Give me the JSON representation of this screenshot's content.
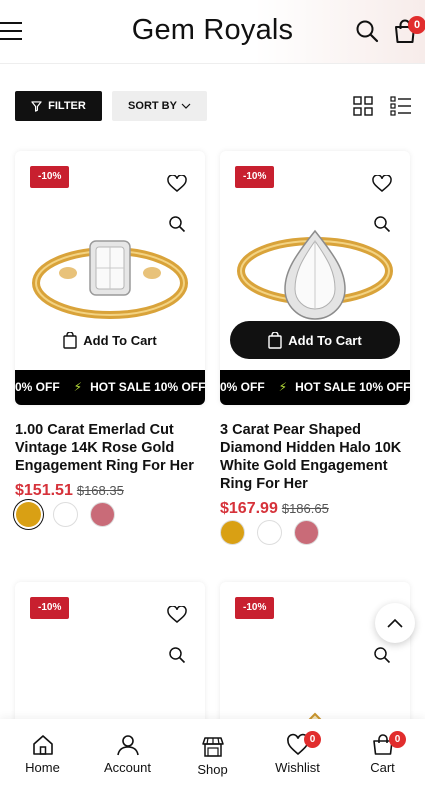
{
  "header": {
    "logo": "Gem Royals",
    "cart_count": "0"
  },
  "toolbar": {
    "filter_label": "FILTER",
    "sort_label": "SORT BY"
  },
  "products": [
    {
      "discount": "-10%",
      "add_to_cart": "Add To Cart",
      "marquee": "0% OFF",
      "marquee2": "HOT SALE 10% OFF",
      "title": "1.00 Carat Emerlad Cut Vintage 14K Rose Gold Engagement Ring For Her",
      "price": "$151.51",
      "old_price": "$168.35",
      "swatch_colors": [
        "#d9a014",
        "#ffffff",
        "#c96b78"
      ]
    },
    {
      "discount": "-10%",
      "add_to_cart": "Add To Cart",
      "marquee": "0% OFF",
      "marquee2": "HOT SALE 10% OFF",
      "title": "3 Carat Pear Shaped Diamond Hidden Halo 10K White Gold Engagement Ring For Her",
      "price": "$167.99",
      "old_price": "$186.65",
      "swatch_colors": [
        "#d9a014",
        "#ffffff",
        "#c96b78"
      ]
    },
    {
      "discount": "-10%"
    },
    {
      "discount": "-10%"
    }
  ],
  "bottom_nav": [
    {
      "label": "Home",
      "icon": "home-icon"
    },
    {
      "label": "Account",
      "icon": "user-icon"
    },
    {
      "label": "Shop",
      "icon": "store-icon"
    },
    {
      "label": "Wishlist",
      "icon": "heart-icon",
      "badge": "0"
    },
    {
      "label": "Cart",
      "icon": "bag-icon",
      "badge": "0"
    }
  ],
  "colors": {
    "accent_red": "#c8202f",
    "price_red": "#d6323a",
    "badge_red": "#e12d2d",
    "dark": "#111111"
  }
}
